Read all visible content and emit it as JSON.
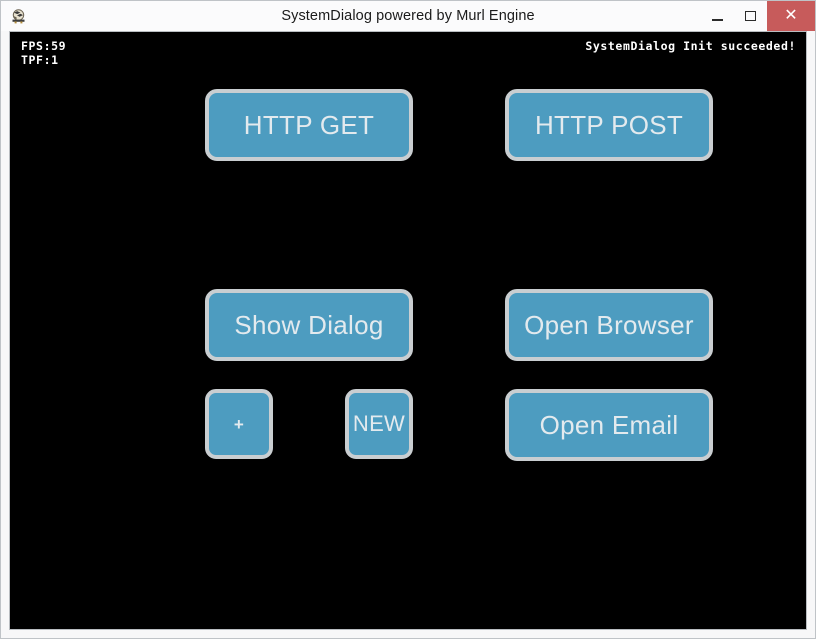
{
  "window": {
    "title": "SystemDialog powered by Murl Engine",
    "icon": "murl-engine-app-icon",
    "controls": {
      "minimize_label": "–",
      "maximize_label": "☐",
      "close_label": "✕"
    },
    "colors": {
      "close_button": "#c75b5b",
      "titlebar": "#fbfbfc",
      "frame": "#f7f7f8",
      "canvas": "#000000"
    }
  },
  "canvas": {
    "hud": {
      "fps_line": "FPS:59",
      "tpf_line": "TPF:1",
      "status": "SystemDialog Init succeeded!",
      "text_color": "#ffffff"
    },
    "button_style": {
      "fill": "#4d9cc0",
      "border": "#c9ced1",
      "label_color": "#e3eaee"
    },
    "buttons": [
      {
        "id": "http-get",
        "label": "HTTP GET",
        "size": "wide"
      },
      {
        "id": "http-post",
        "label": "HTTP POST",
        "size": "wide"
      },
      {
        "id": "show-dialog",
        "label": "Show Dialog",
        "size": "wide"
      },
      {
        "id": "open-browser",
        "label": "Open Browser",
        "size": "wide"
      },
      {
        "id": "plus",
        "label": "+",
        "size": "small"
      },
      {
        "id": "new",
        "label": "NEW",
        "size": "small"
      },
      {
        "id": "open-email",
        "label": "Open Email",
        "size": "wide"
      }
    ]
  }
}
